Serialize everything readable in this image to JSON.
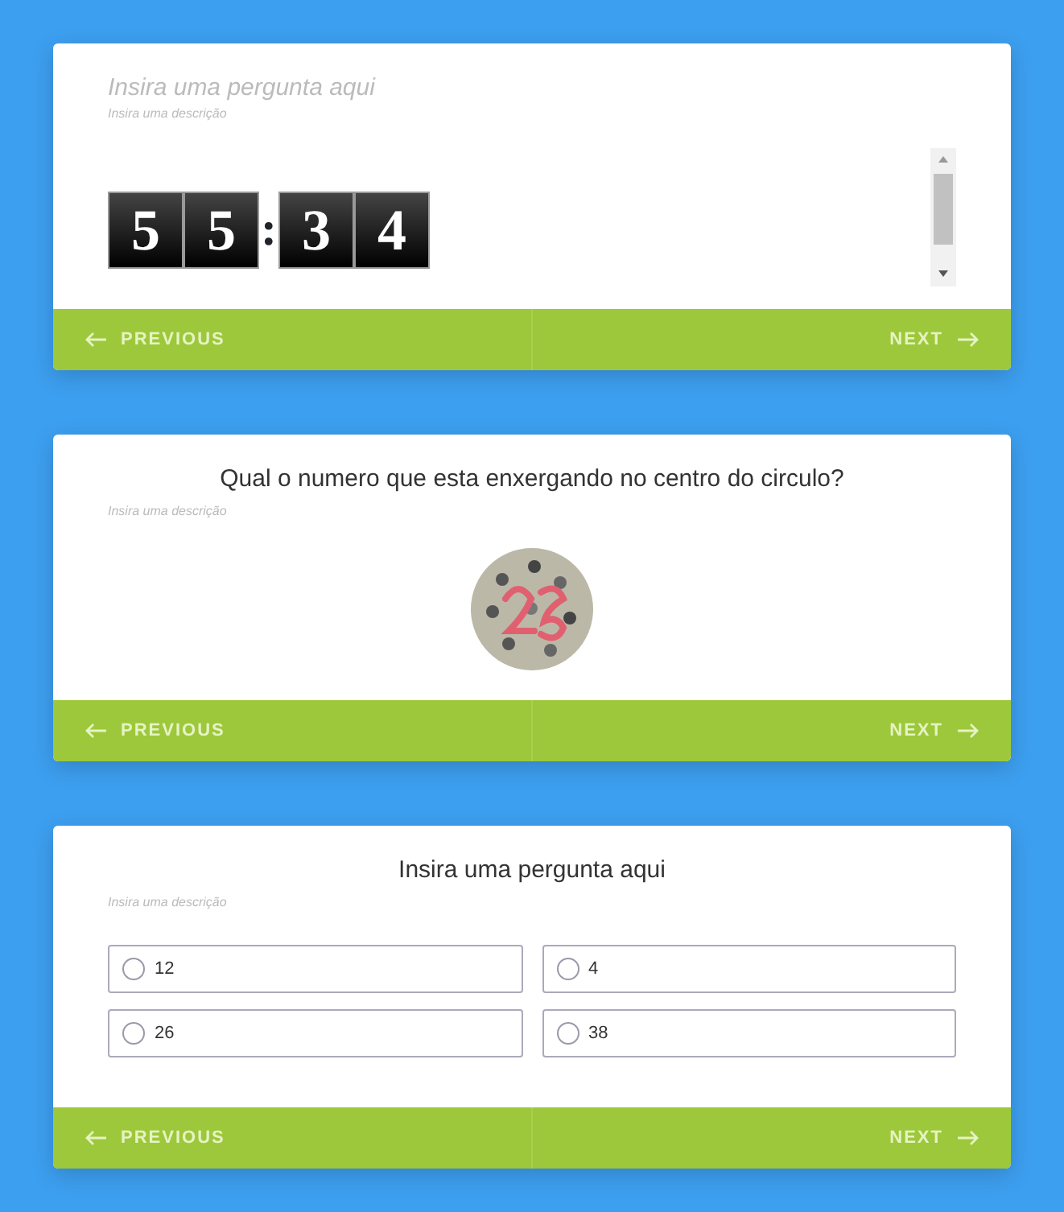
{
  "cards": [
    {
      "kind": "timer",
      "question_placeholder": "Insira uma pergunta aqui",
      "description": "Insira uma descrição",
      "timer": {
        "minutes": [
          "5",
          "5"
        ],
        "separator": ":",
        "seconds": [
          "3",
          "4"
        ]
      },
      "previous": "PREVIOUS",
      "next": "NEXT"
    },
    {
      "question": "Qual o numero que esta enxergando no centro do circulo?",
      "description": "Insira uma descrição",
      "previous": "PREVIOUS",
      "next": "NEXT"
    },
    {
      "kind": "choice",
      "question": "Insira uma pergunta aqui",
      "description": "Insira uma descrição",
      "options": [
        {
          "label": "12",
          "selected": false
        },
        {
          "label": "4",
          "selected": false
        },
        {
          "label": "26",
          "selected": false
        },
        {
          "label": "38",
          "selected": false
        }
      ],
      "previous": "PREVIOUS",
      "next": "NEXT"
    }
  ]
}
